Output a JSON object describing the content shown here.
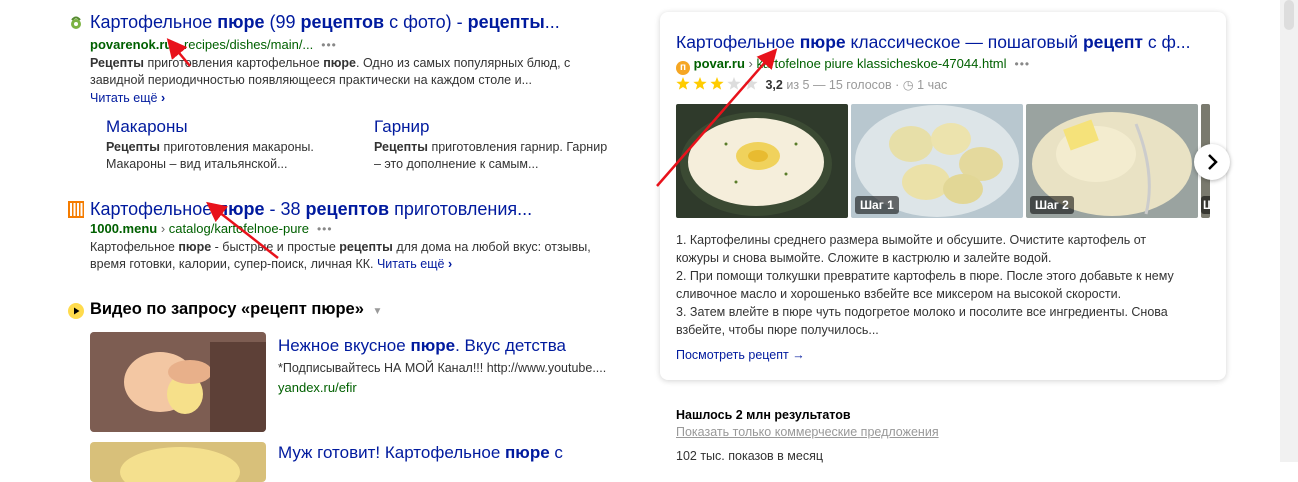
{
  "result1": {
    "title_a": "Картофельное ",
    "title_b": "пюре",
    "title_c": " (99 ",
    "title_d": "рецептов",
    "title_e": " с фото) - ",
    "title_f": "рецепты",
    "title_g": "...",
    "site": "povarenok.ru",
    "path": "recipes/dishes/main/...",
    "snippet_b1": "Рецепты",
    "snippet_1": " приготовления картофельное ",
    "snippet_b2": "пюре",
    "snippet_2": ". Одно из самых популярных блюд, с",
    "snippet_3": "завидной периодичностью появляющееся практически на каждом столе и...",
    "read_more": "Читать ещё",
    "sitelinks": [
      {
        "title": "Макароны",
        "bold": "Рецепты",
        "text1": " приготовления макароны.",
        "text2": "Макароны – вид итальянской..."
      },
      {
        "title": "Гарнир",
        "bold": "Рецепты",
        "text1": " приготовления гарнир. Гарнир",
        "text2": "– это дополнение к самым..."
      }
    ]
  },
  "result2": {
    "title_a": "Картофельное ",
    "title_b": "пюре",
    "title_c": " - 38 ",
    "title_d": "рецептов",
    "title_e": " приготовления...",
    "site": "1000.menu",
    "path": "catalog/kartofelnoe-pure",
    "snippet_1": "Картофельное ",
    "snippet_b1": "пюре",
    "snippet_2": " - быстрые и простые ",
    "snippet_b2": "рецепты",
    "snippet_3": " для дома на любой вкус: отзывы,",
    "snippet_4": "время готовки, калории, супер-поиск, личная КК. ",
    "read_more": "Читать ещё"
  },
  "video": {
    "header": "Видео по запросу «рецепт пюре»",
    "items": [
      {
        "title_a": "Нежное вкусное ",
        "title_b": "пюре",
        "title_c": ". Вкус детства",
        "desc": "*Подписывайтесь НА МОЙ Канал!!! http://www.youtube....",
        "source": "yandex.ru/efir"
      },
      {
        "title_a": "Муж готовит! Картофельное ",
        "title_b": "пюре",
        "title_c": " с"
      }
    ]
  },
  "card": {
    "title_a": "Картофельное ",
    "title_b": "пюре",
    "title_c": " классическое — пошаговый ",
    "title_d": "рецепт",
    "title_e": " с ф...",
    "site": "povar.ru",
    "path": "kartofelnoe piure klassicheskoe-47044.html",
    "rating_value": 3.2,
    "rating_bold": "3,2",
    "rating_rest": " из 5 — 15 голосов",
    "time": "1 час",
    "steps": [
      "Шаг 1",
      "Шаг 2",
      "Ш"
    ],
    "instructions": [
      "1. Картофелины среднего размера вымойте и обсушите. Очистите картофель от",
      "кожуры и снова вымойте. Сложите в кастрюлю и залейте водой.",
      "2. При помощи толкушки превратите картофель в пюре. После этого добавьте к нему",
      "сливочное масло и хорошенько взбейте все миксером на высокой скорости.",
      "3. Затем влейте в пюре чуть подогретое молоко и посолите все ингредиенты. Снова",
      "взбейте, чтобы пюре получилось..."
    ],
    "see_recipe": "Посмотреть рецепт"
  },
  "stats": {
    "found": "Нашлось 2 млн результатов",
    "commercial": "Показать только коммерческие предложения",
    "shows": "102 тыс. показов в месяц"
  },
  "colors": {
    "link": "#001a9e",
    "url_green": "#006000",
    "arrow_red": "#e8121b",
    "star": "#fc0"
  }
}
